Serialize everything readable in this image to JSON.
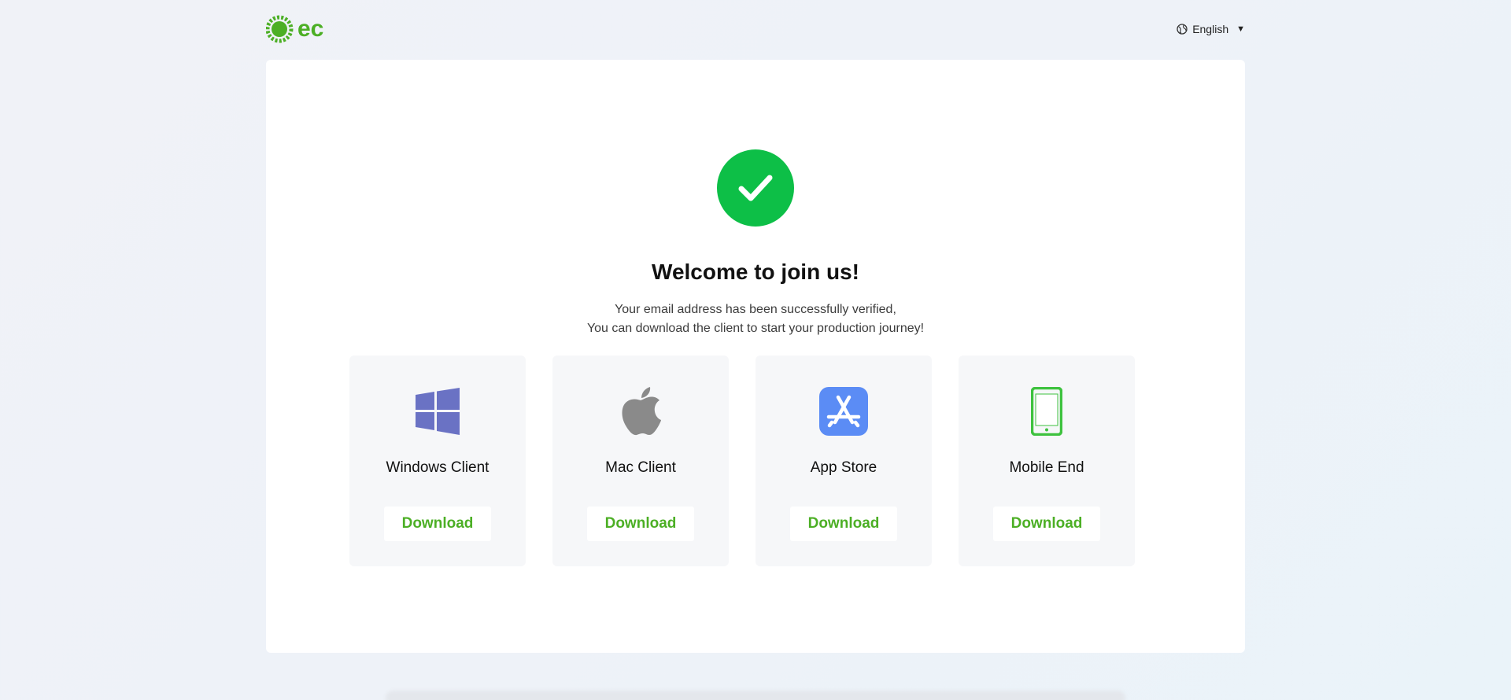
{
  "header": {
    "logo_text": "ec",
    "language": "English"
  },
  "main": {
    "title": "Welcome to join us!",
    "description_line1": "Your email address has been successfully verified,",
    "description_line2": "You can download the client to start your production journey!"
  },
  "downloads": [
    {
      "label": "Windows Client",
      "button": "Download",
      "icon": "windows-icon",
      "color": "#6a72c4"
    },
    {
      "label": "Mac Client",
      "button": "Download",
      "icon": "apple-icon",
      "color": "#8a8a8a"
    },
    {
      "label": "App Store",
      "button": "Download",
      "icon": "app-store-icon",
      "color": "#5b8cf5"
    },
    {
      "label": "Mobile End",
      "button": "Download",
      "icon": "mobile-icon",
      "color": "#3ec23f"
    }
  ],
  "colors": {
    "accent": "#4caf25",
    "success": "#0dbf47"
  }
}
